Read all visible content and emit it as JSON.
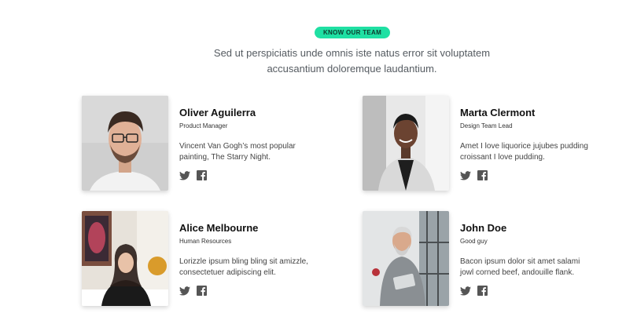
{
  "header": {
    "badge": "KNOW OUR TEAM",
    "intro_line1": "Sed ut perspiciatis unde omnis iste natus error sit voluptatem",
    "intro_line2": "accusantium doloremque laudantium."
  },
  "team": [
    {
      "name": "Oliver Aguilerra",
      "role": "Product Manager",
      "bio_line1": "Vincent Van Gogh’s most popular",
      "bio_line2": "painting, The Starry Night."
    },
    {
      "name": "Marta Clermont",
      "role": "Design Team Lead",
      "bio_line1": "Amet I love liquorice jujubes pudding",
      "bio_line2": "croissant I love pudding."
    },
    {
      "name": "Alice Melbourne",
      "role": "Human Resources",
      "bio_line1": "Lorizzle ipsum bling bling sit amizzle,",
      "bio_line2": "consectetuer adipiscing elit."
    },
    {
      "name": "John Doe",
      "role": "Good guy",
      "bio_line1": "Bacon ipsum dolor sit amet salami",
      "bio_line2": "jowl corned beef, andouille flank."
    }
  ],
  "icons": {
    "twitter": "twitter-icon",
    "facebook": "facebook-icon"
  },
  "colors": {
    "accent": "#1fe0a3",
    "icon": "#555555"
  }
}
